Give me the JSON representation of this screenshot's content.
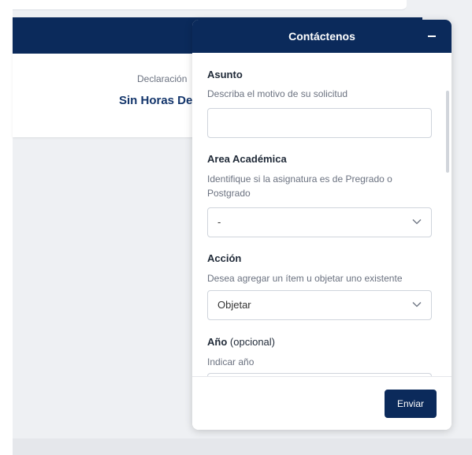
{
  "background": {
    "declaration_label": "Declaración",
    "declaration_value": "Sin Horas De"
  },
  "panel": {
    "title": "Contáctenos",
    "minimize_icon": "minus-icon",
    "fields": {
      "asunto": {
        "label": "Asunto",
        "help": "Describa el motivo de su solicitud",
        "value": ""
      },
      "area": {
        "label": "Area Académica",
        "help": "Identifique si la asignatura es de Pregrado o Postgrado",
        "selected": "-"
      },
      "accion": {
        "label": "Acción",
        "help": "Desea agregar un ítem u objetar uno existente",
        "selected": "Objetar"
      },
      "anio": {
        "label": "Año",
        "optional": "(opcional)",
        "help": "Indicar año"
      }
    },
    "send_label": "Enviar"
  },
  "colors": {
    "header": "#0b2a5b",
    "accent_text": "#13356b"
  }
}
